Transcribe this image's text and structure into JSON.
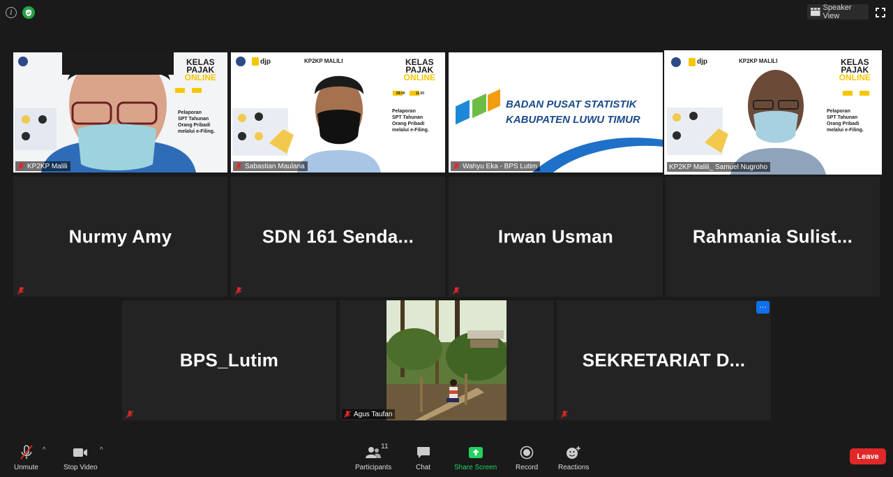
{
  "top_bar": {
    "speaker_view_label": "Speaker View"
  },
  "tiles": [
    {
      "name": "KP2KP Malili",
      "kind": "video"
    },
    {
      "name": "Sabastian Maulana",
      "kind": "video"
    },
    {
      "name": "Wahyu Eka - BPS Lutim",
      "kind": "video"
    },
    {
      "name": "KP2KP Malili_ Samuel Nugroho",
      "kind": "video",
      "active_speaker": true
    },
    {
      "name": "Nurmy Amy",
      "kind": "name"
    },
    {
      "name": "SDN 161 Senda...",
      "kind": "name"
    },
    {
      "name": "Irwan Usman",
      "kind": "name"
    },
    {
      "name": "Rahmania Sulist...",
      "kind": "name"
    },
    {
      "name": "BPS_Lutim",
      "kind": "name"
    },
    {
      "name": "Agus Taufan",
      "kind": "video"
    },
    {
      "name": "SEKRETARIAT D...",
      "kind": "name"
    }
  ],
  "slides": {
    "kelas": "KELAS",
    "pajak": "PAJAK",
    "online": "ONLINE",
    "djp": "djp",
    "kp2kp": "KP2KP MALILI",
    "desc_1": "Pelaporan",
    "desc_2": "SPT Tahunan",
    "desc_3": "Orang Pribadi",
    "desc_4": "melalui e-Filing.",
    "time_start": "09.00",
    "time_end": "11.00"
  },
  "bps_banner": {
    "line1": "BADAN PUSAT STATISTIK",
    "line2": "KABUPATEN LUWU TIMUR"
  },
  "toolbar": {
    "unmute_label": "Unmute",
    "stop_video_label": "Stop Video",
    "participants_label": "Participants",
    "participants_count": "11",
    "chat_label": "Chat",
    "share_screen_label": "Share Screen",
    "record_label": "Record",
    "reactions_label": "Reactions",
    "leave_label": "Leave"
  },
  "colors": {
    "background": "#1a1a1a",
    "tile": "#232323",
    "active_speaker_border": "#b2d235",
    "share_green": "#23d160",
    "leave_red": "#e02828",
    "more_blue": "#0e71eb"
  },
  "more_button_label": "···"
}
